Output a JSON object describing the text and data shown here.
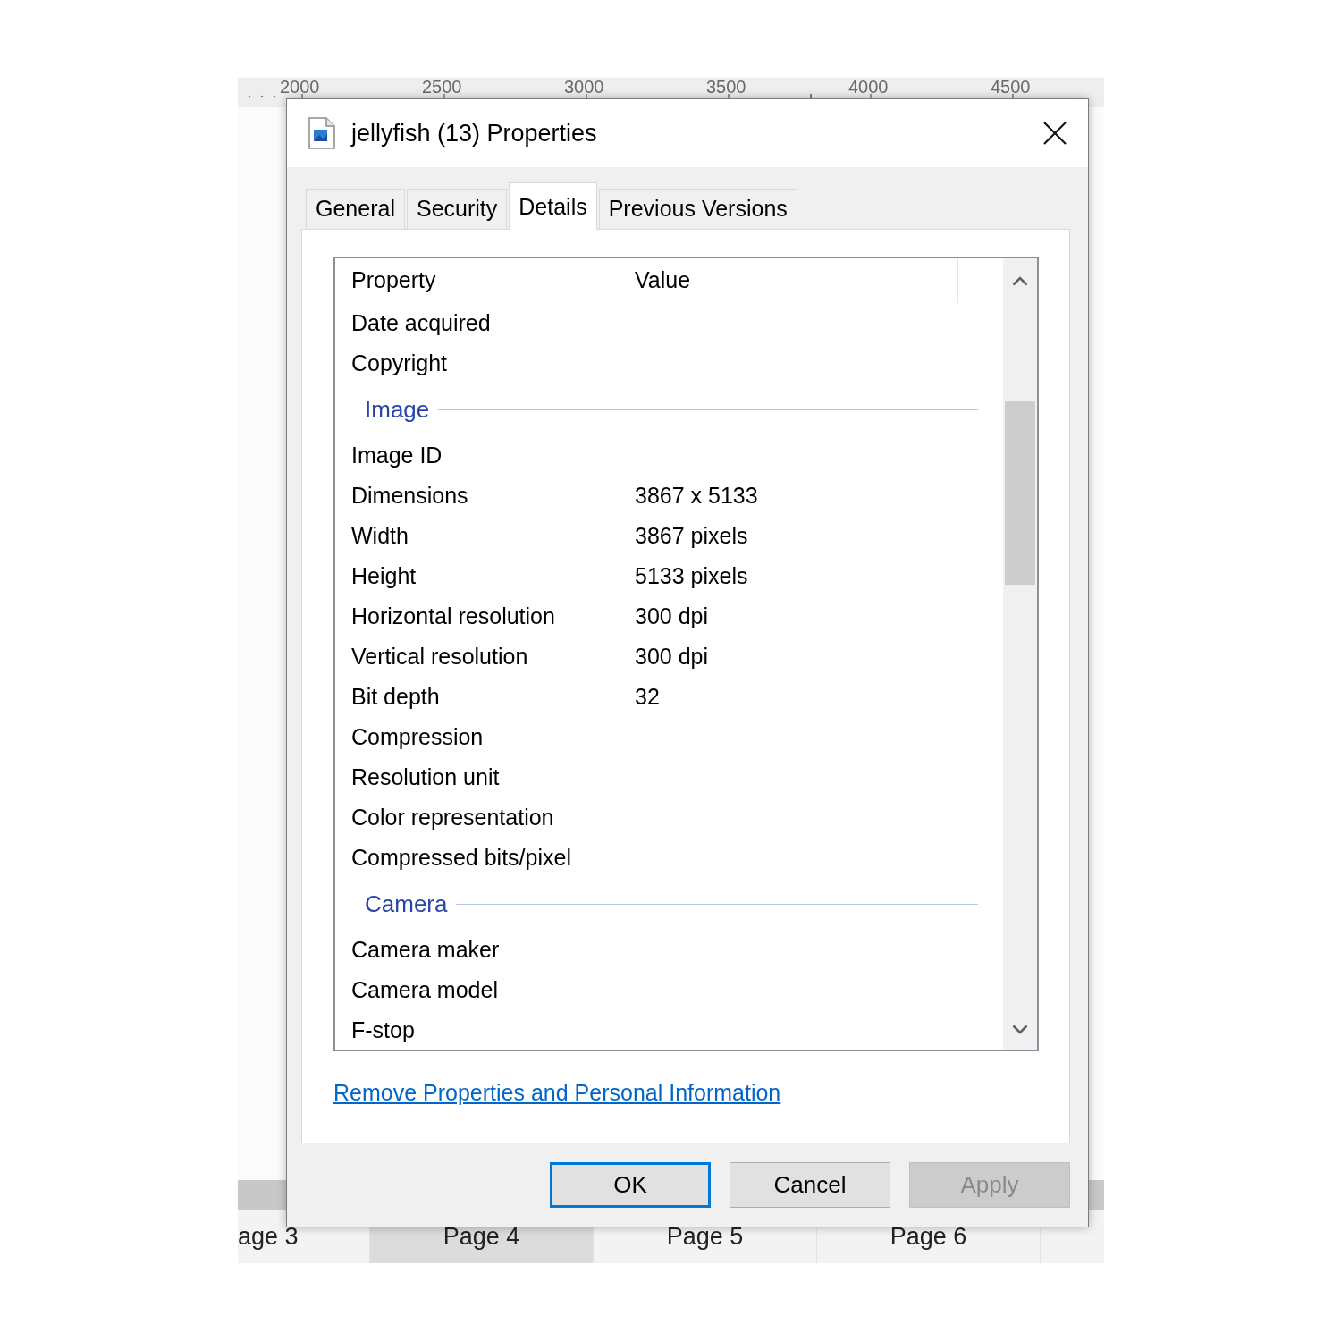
{
  "app": {
    "ruler": {
      "labels": [
        "2000",
        "2500",
        "3000",
        "3500",
        "4000",
        "4500"
      ]
    },
    "page_tabs": [
      {
        "label": "age 3",
        "selected": false
      },
      {
        "label": "Page 4",
        "selected": true
      },
      {
        "label": "Page 5",
        "selected": false
      },
      {
        "label": "Page 6",
        "selected": false
      }
    ]
  },
  "dialog": {
    "title": "jellyfish (13) Properties",
    "tabs": [
      {
        "label": "General",
        "selected": false
      },
      {
        "label": "Security",
        "selected": false
      },
      {
        "label": "Details",
        "selected": true
      },
      {
        "label": "Previous Versions",
        "selected": false
      }
    ],
    "details": {
      "columns": [
        "Property",
        "Value"
      ],
      "rows": [
        {
          "kind": "property",
          "name": "Date acquired"
        },
        {
          "kind": "property",
          "name": "Copyright"
        },
        {
          "kind": "group",
          "label": "Image"
        },
        {
          "kind": "property",
          "name": "Image ID"
        },
        {
          "kind": "property",
          "name": "Dimensions",
          "value": "3867 x 5133"
        },
        {
          "kind": "property",
          "name": "Width",
          "value": "3867 pixels"
        },
        {
          "kind": "property",
          "name": "Height",
          "value": "5133 pixels"
        },
        {
          "kind": "property",
          "name": "Horizontal resolution",
          "value": "300 dpi"
        },
        {
          "kind": "property",
          "name": "Vertical resolution",
          "value": "300 dpi"
        },
        {
          "kind": "property",
          "name": "Bit depth",
          "value": "32"
        },
        {
          "kind": "property",
          "name": "Compression"
        },
        {
          "kind": "property",
          "name": "Resolution unit"
        },
        {
          "kind": "property",
          "name": "Color representation"
        },
        {
          "kind": "property",
          "name": "Compressed bits/pixel"
        },
        {
          "kind": "group",
          "label": "Camera"
        },
        {
          "kind": "property",
          "name": "Camera maker"
        },
        {
          "kind": "property",
          "name": "Camera model"
        },
        {
          "kind": "property",
          "name": "F-stop"
        }
      ]
    },
    "link": "Remove Properties and Personal Information",
    "buttons": [
      {
        "label": "OK",
        "focused": true,
        "disabled": false
      },
      {
        "label": "Cancel",
        "focused": false,
        "disabled": false
      },
      {
        "label": "Apply",
        "focused": false,
        "disabled": true
      }
    ]
  }
}
